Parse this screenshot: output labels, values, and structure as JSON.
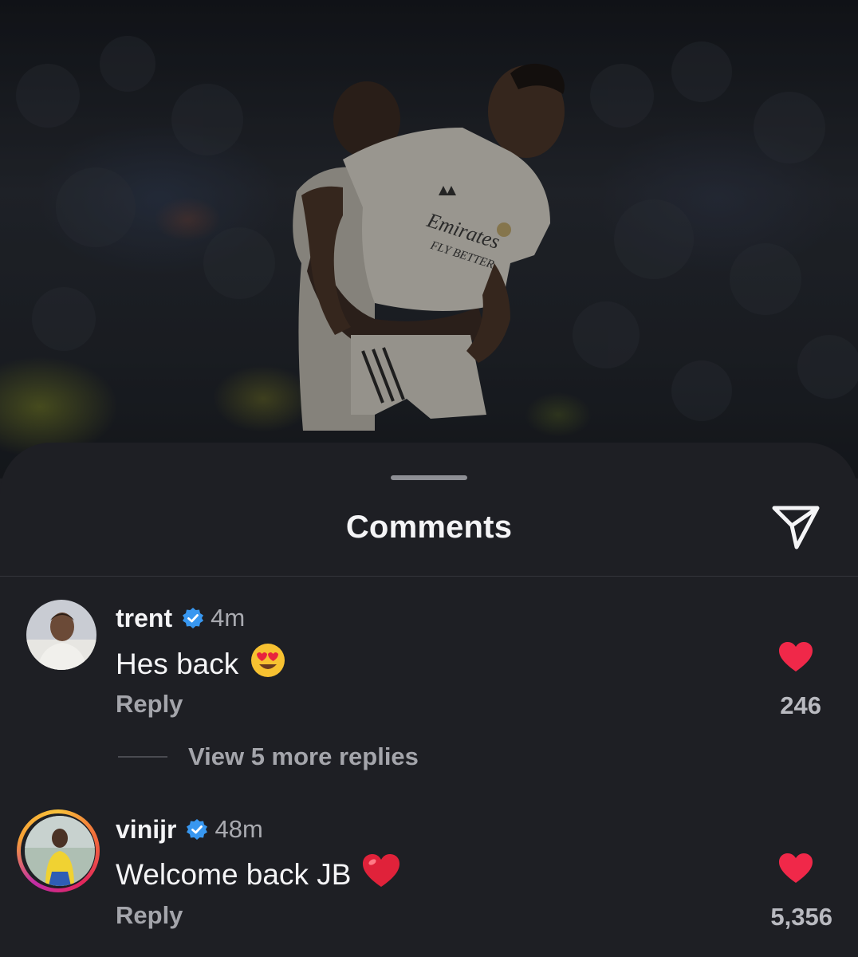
{
  "sheet": {
    "title": "Comments"
  },
  "icons": {
    "send": "paper-plane-icon",
    "verified": "verified-badge-icon",
    "like": "heart-icon",
    "emoji_heart_eyes": "heart-eyes-emoji",
    "emoji_red_heart": "red-heart-emoji"
  },
  "colors": {
    "background": "#1e1f24",
    "verified": "#3897f0",
    "like": "#f02849"
  },
  "photo": {
    "jersey_text_1": "Emirates",
    "jersey_text_2": "FLY BETTER"
  },
  "comments": [
    {
      "username": "trent",
      "time": "4m",
      "text": "Hes back",
      "emoji": "😍",
      "reply_label": "Reply",
      "likes": "246",
      "liked": true
    },
    {
      "username": "vinijr",
      "time": "48m",
      "text": "Welcome back JB",
      "emoji": "❤️",
      "reply_label": "Reply",
      "likes": "5,356",
      "liked": true,
      "has_story": true
    }
  ],
  "view_more_replies": "View 5 more replies"
}
